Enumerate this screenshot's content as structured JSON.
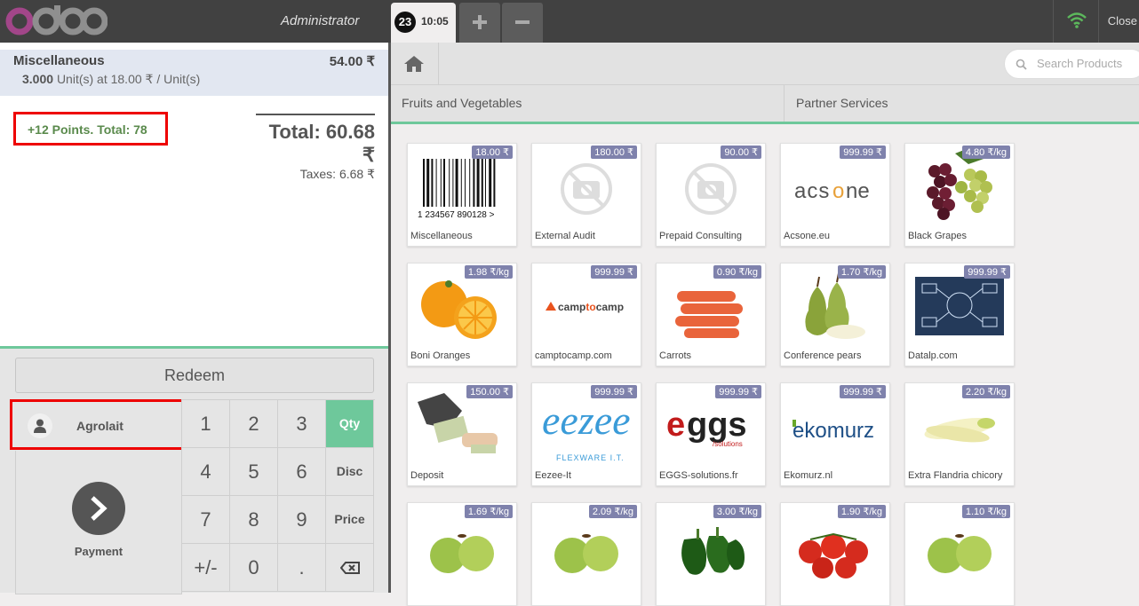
{
  "header": {
    "logo_text": "odoo",
    "user": "Administrator",
    "order": {
      "sequence": "23",
      "time": "10:05"
    },
    "close_label": "Close"
  },
  "order": {
    "line": {
      "product": "Miscellaneous",
      "price": "54.00 ₹",
      "qty": "3.000",
      "unit_info": "Unit(s) at 18.00 ₹ / Unit(s)"
    },
    "loyalty": "+12 Points. Total: 78",
    "total": "Total: 60.68 ₹",
    "taxes": "Taxes: 6.68 ₹"
  },
  "controls": {
    "redeem_label": "Redeem",
    "customer": "Agrolait",
    "payment_label": "Payment",
    "numpad": [
      "1",
      "2",
      "3",
      "Qty",
      "4",
      "5",
      "6",
      "Disc",
      "7",
      "8",
      "9",
      "Price",
      "+/-",
      "0",
      "."
    ]
  },
  "search": {
    "placeholder": "Search Products"
  },
  "categories": [
    "Fruits and Vegetables",
    "Partner Services"
  ],
  "products": [
    {
      "name": "Miscellaneous",
      "price": "18.00 ₹",
      "icon": "barcode-image"
    },
    {
      "name": "External Audit",
      "price": "180.00 ₹",
      "icon": "no-image-icon"
    },
    {
      "name": "Prepaid Consulting",
      "price": "90.00 ₹",
      "icon": "no-image-icon"
    },
    {
      "name": "Acsone.eu",
      "price": "999.99 ₹",
      "icon": "acsone-logo",
      "logo_text": "acsone"
    },
    {
      "name": "Black Grapes",
      "price": "4.80 ₹/kg",
      "icon": "grapes-image"
    },
    {
      "name": "Boni Oranges",
      "price": "1.98 ₹/kg",
      "icon": "oranges-image"
    },
    {
      "name": "camptocamp.com",
      "price": "999.99 ₹",
      "icon": "camptocamp-logo",
      "logo_text": "camptocamp"
    },
    {
      "name": "Carrots",
      "price": "0.90 ₹/kg",
      "icon": "carrots-image"
    },
    {
      "name": "Conference pears",
      "price": "1.70 ₹/kg",
      "icon": "pears-image"
    },
    {
      "name": "Datalp.com",
      "price": "999.99 ₹",
      "icon": "datalp-image"
    },
    {
      "name": "Deposit",
      "price": "150.00 ₹",
      "icon": "deposit-image"
    },
    {
      "name": "Eezee-It",
      "price": "999.99 ₹",
      "icon": "eezee-logo",
      "logo_text": "FLEXWARE IT"
    },
    {
      "name": "EGGS-solutions.fr",
      "price": "999.99 ₹",
      "icon": "eggs-logo",
      "logo_text": "eggs"
    },
    {
      "name": "Ekomurz.nl",
      "price": "999.99 ₹",
      "icon": "ekomurz-logo",
      "logo_text": "ekomurz"
    },
    {
      "name": "Extra Flandria chicory",
      "price": "2.20 ₹/kg",
      "icon": "chicory-image"
    },
    {
      "name": "",
      "price": "1.69 ₹/kg",
      "icon": "apples-image"
    },
    {
      "name": "",
      "price": "2.09 ₹/kg",
      "icon": "apples-image"
    },
    {
      "name": "",
      "price": "3.00 ₹/kg",
      "icon": "peppers-image"
    },
    {
      "name": "",
      "price": "1.90 ₹/kg",
      "icon": "tomatoes-image"
    },
    {
      "name": "",
      "price": "1.10 ₹/kg",
      "icon": "apples-image"
    }
  ]
}
